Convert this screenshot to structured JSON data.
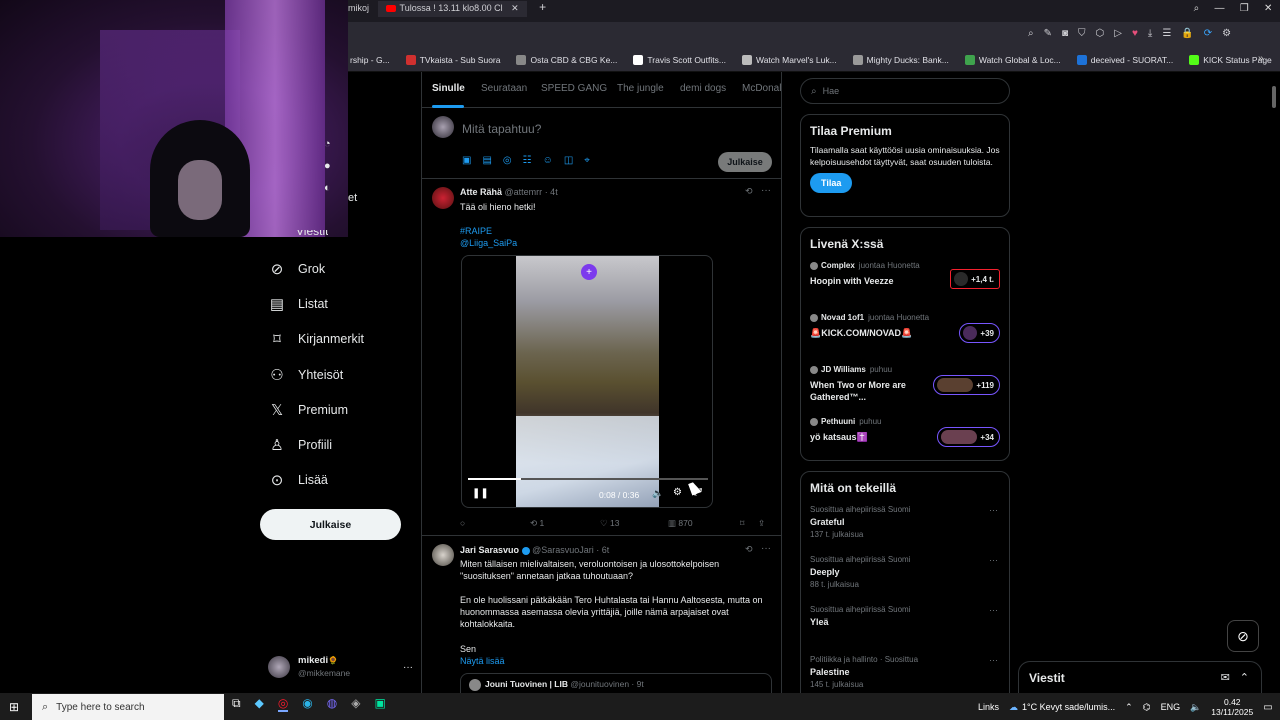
{
  "browser": {
    "tab_prefix": "mikoj",
    "active_tab": "Tulossa ! 13.11 klo8.00 Cl",
    "bookmarks": [
      {
        "label": "rship - G...",
        "color": "#555"
      },
      {
        "label": "TVkaista - Sub Suora",
        "color": "#d0302f"
      },
      {
        "label": "Osta CBD & CBG Ke...",
        "color": "#888"
      },
      {
        "label": "Travis Scott Outfits...",
        "color": "#ffffff"
      },
      {
        "label": "Watch Marvel's Luk...",
        "color": "#bbbbbb"
      },
      {
        "label": "Mighty Ducks: Bank...",
        "color": "#999999"
      },
      {
        "label": "Watch Global & Loc...",
        "color": "#3fa34d"
      },
      {
        "label": "deceived - SUORAT...",
        "color": "#1d72d8"
      },
      {
        "label": "KICK Status Page",
        "color": "#53fc18"
      }
    ]
  },
  "sidebar": {
    "partial_item": "Viestit",
    "items": [
      {
        "label": "Grok",
        "icon": "grok-icon"
      },
      {
        "label": "Listat",
        "icon": "list-icon"
      },
      {
        "label": "Kirjanmerkit",
        "icon": "bookmark-icon"
      },
      {
        "label": "Yhteisöt",
        "icon": "communities-icon"
      },
      {
        "label": "Premium",
        "icon": "x-logo-icon"
      },
      {
        "label": "Profiili",
        "icon": "profile-icon"
      },
      {
        "label": "Lisää",
        "icon": "more-icon"
      }
    ],
    "post_button": "Julkaise",
    "account": {
      "name": "mikedi",
      "badge": "🌻",
      "handle": "@mikkemane",
      "more": "···"
    }
  },
  "feed": {
    "tabs": [
      "Sinulle",
      "Seurataan",
      "SPEED GANG",
      "The jungle",
      "demi dogs",
      "McDonal"
    ],
    "composer": {
      "placeholder": "Mitä tapahtuu?",
      "post": "Julkaise"
    },
    "tweet1": {
      "name": "Atte Rähä",
      "handle": "@attemrr",
      "time": "· 4t",
      "text": "Tää oli hieno hetki!",
      "hashtag": "#RAIPE",
      "mention": "@Liiga_SaiPa",
      "video_time": "0:08 / 0:36",
      "video_progress": 0.22,
      "replies": "",
      "retweets": "1",
      "likes": "13",
      "views": "870"
    },
    "tweet2": {
      "name": "Jari Sarasvuo",
      "handle": "@SarasvuoJari",
      "time": "· 6t",
      "para1": "Miten tällaisen mielivaltaisen, veroluontoisen ja ulosottokelpoisen \"suosituksen\" annetaan jatkaa tuhoutuaan?",
      "para2": "En ole huolissani pätkäkään Tero Huhtalasta tai Hannu Aaltosesta, mutta on huonommassa asemassa olevia yrittäjiä, joille nämä arpajaiset ovat kohtalokkaita.",
      "cut": "Sen",
      "show_more": "Näytä lisää",
      "quoted_name": "Jouni Tuovinen | LIB",
      "quoted_handle": "@jounituovinen · 9t"
    }
  },
  "right": {
    "search_placeholder": "Hae",
    "premium": {
      "title": "Tilaa Premium",
      "body": "Tilaamalla saat käyttöösi uusia ominaisuuksia. Jos kelpoisuusehdot täyttyvät, saat osuuden tuloista.",
      "button": "Tilaa"
    },
    "live": {
      "title": "Livenä X:ssä",
      "items": [
        {
          "host": "Complex",
          "role": "juontaa Huonetta",
          "title": "Hoopin with Veezze",
          "count": "+1,4 t."
        },
        {
          "host": "Novad 1of1",
          "role": "juontaa Huonetta",
          "title": "🚨KICK.COM/NOVAD🚨",
          "count": "+39"
        },
        {
          "host": "JD Williams",
          "role": "puhuu",
          "title": "When Two or More are Gathered™...",
          "count": "+119"
        },
        {
          "host": "Pethuuni",
          "role": "puhuu",
          "title": "yö katsaus✝️",
          "count": "+34"
        }
      ]
    },
    "trends": {
      "title": "Mitä on tekeillä",
      "items": [
        {
          "ctx": "Suosittua aihepiirissä Suomi",
          "name": "Grateful",
          "posts": "137 t. julkaisua"
        },
        {
          "ctx": "Suosittua aihepiirissä Suomi",
          "name": "Deeply",
          "posts": "88 t. julkaisua"
        },
        {
          "ctx": "Suosittua aihepiirissä Suomi",
          "name": "Yleä",
          "posts": ""
        },
        {
          "ctx": "Politiikka ja hallinto · Suosittua",
          "name": "Palestine",
          "posts": "145 t. julkaisua"
        }
      ]
    },
    "messages": "Viestit"
  },
  "taskbar": {
    "search_placeholder": "Type here to search",
    "links": "Links",
    "weather": "1°C  Kevyt sade/lumis...",
    "lang": "ENG",
    "time": "0.42",
    "date": "13/11/2025"
  }
}
